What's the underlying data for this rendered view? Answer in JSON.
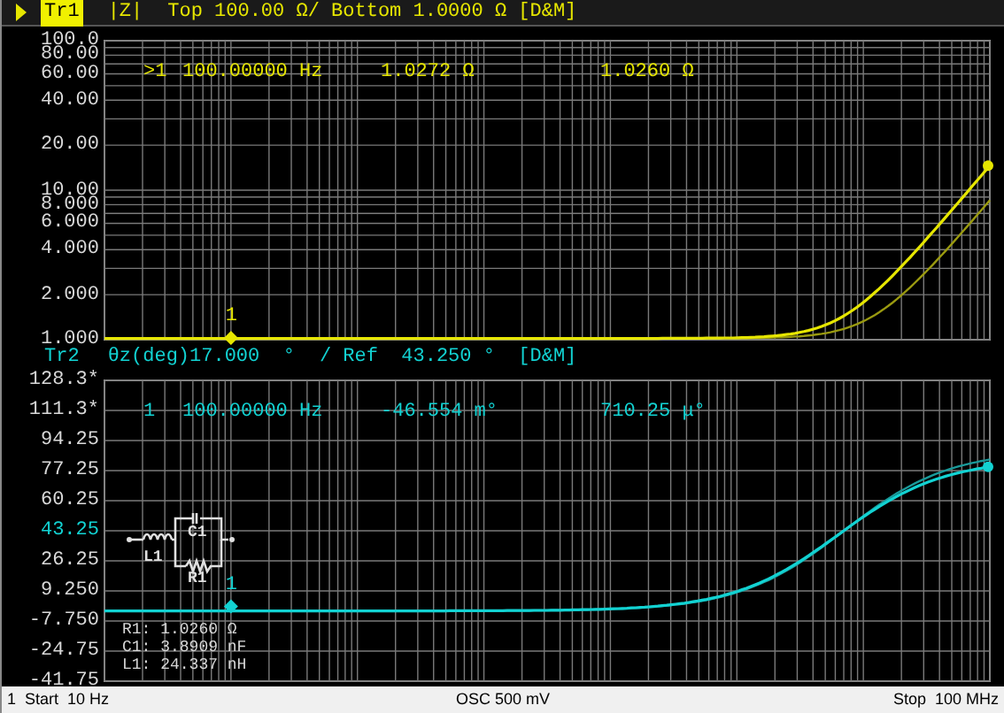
{
  "traces": [
    {
      "tab": "Tr1",
      "selected": true,
      "format": "|Z|",
      "scale": "Top 100.00 Ω/ Bottom 1.0000 Ω [D&M]",
      "y_labels": [
        {
          "text": "100.0",
          "reference": false
        },
        {
          "text": "80.00",
          "reference": false
        },
        {
          "text": "60.00",
          "reference": false
        },
        {
          "text": "40.00",
          "reference": false
        },
        {
          "text": "20.00",
          "reference": false
        },
        {
          "text": "10.00",
          "reference": false
        },
        {
          "text": "8.000",
          "reference": false
        },
        {
          "text": "6.000",
          "reference": false
        },
        {
          "text": "4.000",
          "reference": false
        },
        {
          "text": "2.000",
          "reference": false
        },
        {
          "text": "1.000",
          "reference": false
        }
      ],
      "readout": {
        "marker": ">1",
        "frequency": "100.00000 Hz",
        "value": "1.0272 Ω",
        "value_2": "1.0260 Ω"
      },
      "marker_label": "1"
    },
    {
      "tab": "Tr2",
      "selected": false,
      "format": "θz(deg)17.000  °",
      "scale": "/ Ref  43.250 °  [D&M]",
      "y_labels": [
        {
          "text": "128.3*",
          "reference": false
        },
        {
          "text": "111.3*",
          "reference": false
        },
        {
          "text": "94.25",
          "reference": false
        },
        {
          "text": "77.25",
          "reference": false
        },
        {
          "text": "60.25",
          "reference": false
        },
        {
          "text": "43.25",
          "reference": true
        },
        {
          "text": "26.25",
          "reference": false
        },
        {
          "text": "9.250",
          "reference": false
        },
        {
          "text": "-7.750",
          "reference": false
        },
        {
          "text": "-24.75",
          "reference": false
        },
        {
          "text": "-41.75",
          "reference": false
        }
      ],
      "readout": {
        "marker": "1",
        "frequency": "100.00000 Hz",
        "value": "-46.554 m°",
        "value_2": "710.25 μ°"
      },
      "marker_label": "1"
    }
  ],
  "circuit": {
    "labels": [
      "L1",
      "C1",
      "R1"
    ],
    "values": [
      "R1: 1.0260 Ω",
      "C1: 3.8909 nF",
      "L1: 24.337 nH"
    ]
  },
  "status_bar": {
    "start": "1  Start  10 Hz",
    "osc": "OSC 500 mV",
    "stop": "Stop  100 MHz"
  }
}
